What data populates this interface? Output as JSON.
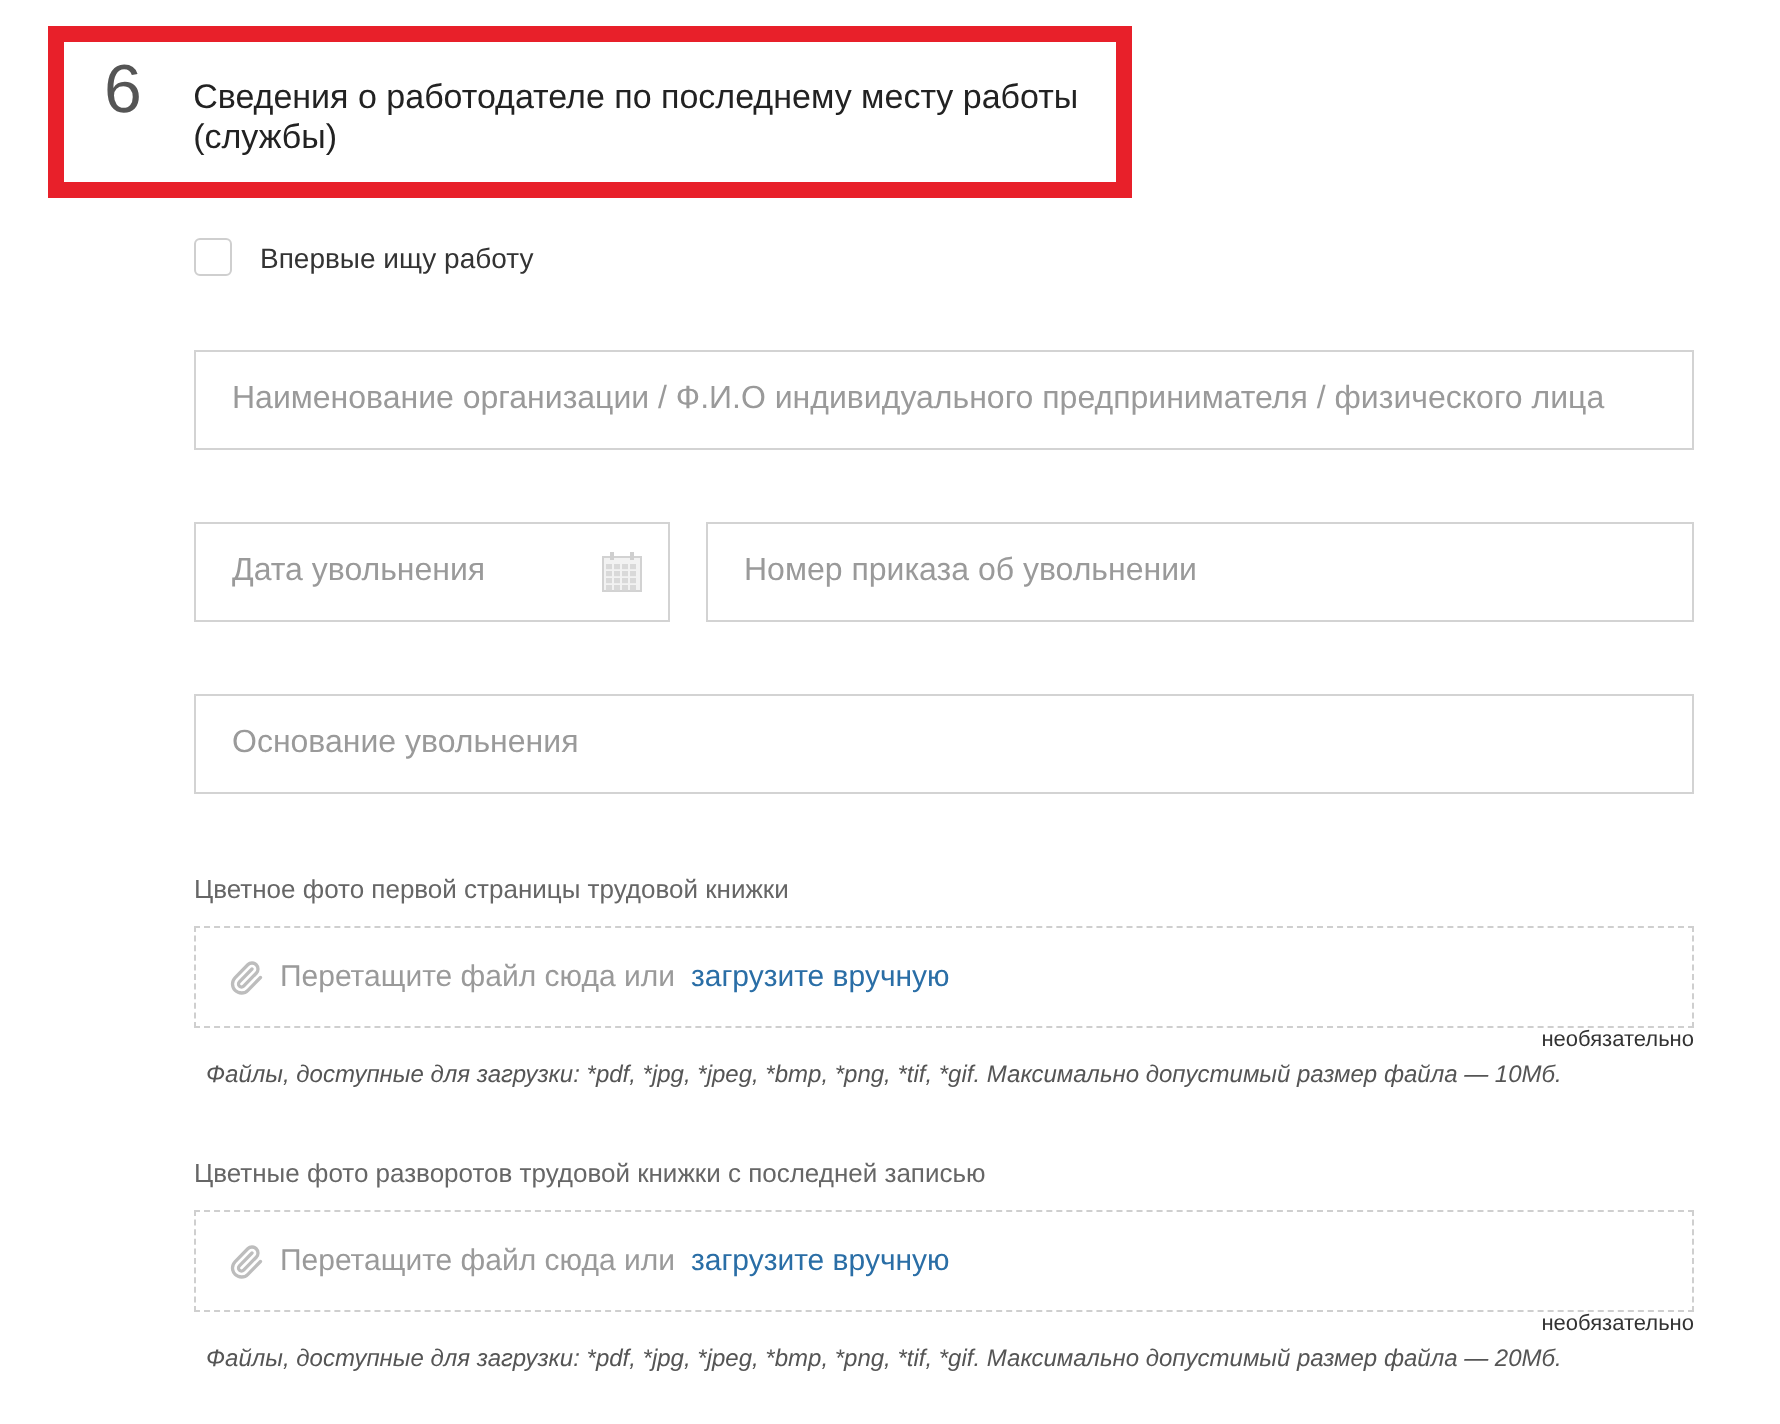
{
  "section": {
    "number": "6",
    "title": "Сведения о работодателе по последнему месту работы (службы)",
    "highlighted": true
  },
  "first_job_checkbox": {
    "label": "Впервые ищу работу",
    "checked": false
  },
  "field_rows": [
    {
      "fields": [
        {
          "kind": "text",
          "placeholder": "Наименование организации / Ф.И.О индивидуального предпринимателя / физического лица"
        }
      ]
    },
    {
      "fields": [
        {
          "kind": "date",
          "placeholder": "Дата увольнения"
        },
        {
          "kind": "text",
          "placeholder": "Номер приказа об увольнении"
        }
      ]
    },
    {
      "fields": [
        {
          "kind": "text",
          "placeholder": "Основание увольнения"
        }
      ]
    }
  ],
  "uploads": [
    {
      "label": "Цветное фото первой страницы трудовой книжки",
      "drop_text": "Перетащите файл сюда или",
      "link": "загрузите вручную",
      "optional_note": "необязательно",
      "hint": "Файлы, доступные для загрузки: *pdf, *jpg, *jpeg, *bmp, *png, *tif, *gif. Максимально допустимый размер файла — 10Мб."
    },
    {
      "label": "Цветные фото разворотов трудовой книжки с последней записью",
      "drop_text": "Перетащите файл сюда или",
      "link": "загрузите вручную",
      "optional_note": "необязательно",
      "hint": "Файлы, доступные для загрузки: *pdf, *jpg, *jpeg, *bmp, *png, *tif, *gif. Максимально допустимый размер файла — 20Мб."
    }
  ]
}
